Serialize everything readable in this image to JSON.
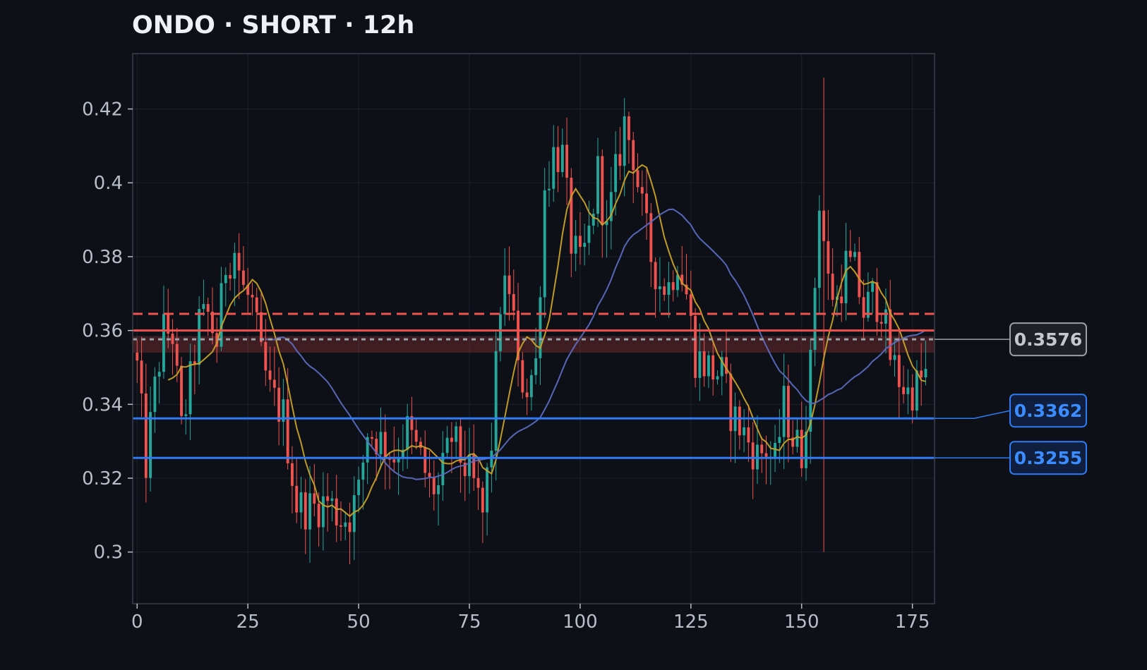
{
  "title": "ONDO · SHORT · 12h",
  "colors": {
    "background": "#0d1017",
    "up": "#26a69a",
    "down": "#ef5350",
    "ma_fast": "#c9a227",
    "ma_slow": "#5c6bc0",
    "level_blue": "#2f7bf5",
    "level_red": "#ef5350",
    "level_gray": "#9aa0a6"
  },
  "chart_data": {
    "type": "candlestick",
    "title": "ONDO · SHORT · 12h",
    "xlim": [
      -1,
      180
    ],
    "ylim": [
      0.286,
      0.435
    ],
    "x_ticks": [
      0,
      25,
      50,
      75,
      100,
      125,
      150,
      175
    ],
    "y_ticks": [
      0.3,
      0.32,
      0.34,
      0.36,
      0.38,
      0.4,
      0.42
    ],
    "y_tick_labels": [
      "0.3",
      "0.32",
      "0.34",
      "0.36",
      "0.38",
      "0.4",
      "0.42"
    ],
    "grid": true,
    "levels": [
      {
        "value": 0.3576,
        "label": "0.3576",
        "style": "dotted",
        "color": "#9aa0a6"
      },
      {
        "value": 0.3362,
        "label": "0.3362",
        "style": "solid",
        "color": "#2f7bf5"
      },
      {
        "value": 0.3255,
        "label": "0.3255",
        "style": "solid",
        "color": "#2f7bf5"
      },
      {
        "value": 0.36,
        "label": "",
        "style": "solid",
        "color": "#ef5350"
      },
      {
        "value": 0.3645,
        "label": "",
        "style": "dashed",
        "color": "#ef5350"
      }
    ],
    "zone": {
      "from": 0.354,
      "to": 0.3585
    },
    "anchors": [
      [
        0,
        0.35
      ],
      [
        2,
        0.324
      ],
      [
        4,
        0.344
      ],
      [
        6,
        0.36
      ],
      [
        8,
        0.359
      ],
      [
        10,
        0.333
      ],
      [
        12,
        0.346
      ],
      [
        14,
        0.362
      ],
      [
        16,
        0.364
      ],
      [
        18,
        0.357
      ],
      [
        20,
        0.378
      ],
      [
        22,
        0.382
      ],
      [
        24,
        0.371
      ],
      [
        26,
        0.367
      ],
      [
        28,
        0.352
      ],
      [
        30,
        0.343
      ],
      [
        33,
        0.337
      ],
      [
        36,
        0.313
      ],
      [
        38,
        0.312
      ],
      [
        40,
        0.312
      ],
      [
        43,
        0.314
      ],
      [
        46,
        0.309
      ],
      [
        48,
        0.31
      ],
      [
        50,
        0.316
      ],
      [
        52,
        0.333
      ],
      [
        55,
        0.33
      ],
      [
        58,
        0.326
      ],
      [
        61,
        0.333
      ],
      [
        64,
        0.325
      ],
      [
        66,
        0.318
      ],
      [
        68,
        0.317
      ],
      [
        71,
        0.331
      ],
      [
        74,
        0.323
      ],
      [
        76,
        0.318
      ],
      [
        78,
        0.31
      ],
      [
        80,
        0.33
      ],
      [
        82,
        0.368
      ],
      [
        84,
        0.372
      ],
      [
        85,
        0.363
      ],
      [
        86,
        0.348
      ],
      [
        88,
        0.345
      ],
      [
        90,
        0.351
      ],
      [
        92,
        0.398
      ],
      [
        94,
        0.408
      ],
      [
        96,
        0.407
      ],
      [
        98,
        0.384
      ],
      [
        100,
        0.377
      ],
      [
        102,
        0.386
      ],
      [
        104,
        0.403
      ],
      [
        106,
        0.386
      ],
      [
        108,
        0.402
      ],
      [
        110,
        0.416
      ],
      [
        112,
        0.408
      ],
      [
        114,
        0.392
      ],
      [
        116,
        0.38
      ],
      [
        118,
        0.373
      ],
      [
        120,
        0.372
      ],
      [
        122,
        0.38
      ],
      [
        124,
        0.37
      ],
      [
        126,
        0.353
      ],
      [
        128,
        0.351
      ],
      [
        130,
        0.349
      ],
      [
        132,
        0.348
      ],
      [
        134,
        0.338
      ],
      [
        136,
        0.334
      ],
      [
        138,
        0.33
      ],
      [
        140,
        0.326
      ],
      [
        142,
        0.328
      ],
      [
        144,
        0.324
      ],
      [
        146,
        0.34
      ],
      [
        148,
        0.331
      ],
      [
        150,
        0.327
      ],
      [
        152,
        0.35
      ],
      [
        154,
        0.396
      ],
      [
        156,
        0.373
      ],
      [
        158,
        0.368
      ],
      [
        160,
        0.378
      ],
      [
        162,
        0.376
      ],
      [
        164,
        0.365
      ],
      [
        166,
        0.369
      ],
      [
        168,
        0.367
      ],
      [
        170,
        0.353
      ],
      [
        172,
        0.347
      ],
      [
        174,
        0.343
      ],
      [
        176,
        0.345
      ],
      [
        178,
        0.348
      ]
    ],
    "moving_averages": [
      {
        "name": "",
        "window": 8,
        "color": "#c9a227"
      },
      {
        "name": "",
        "window": 30,
        "color": "#5c6bc0"
      }
    ]
  },
  "badges": {
    "gray": "0.3576",
    "blue1": "0.3362",
    "blue2": "0.3255"
  }
}
